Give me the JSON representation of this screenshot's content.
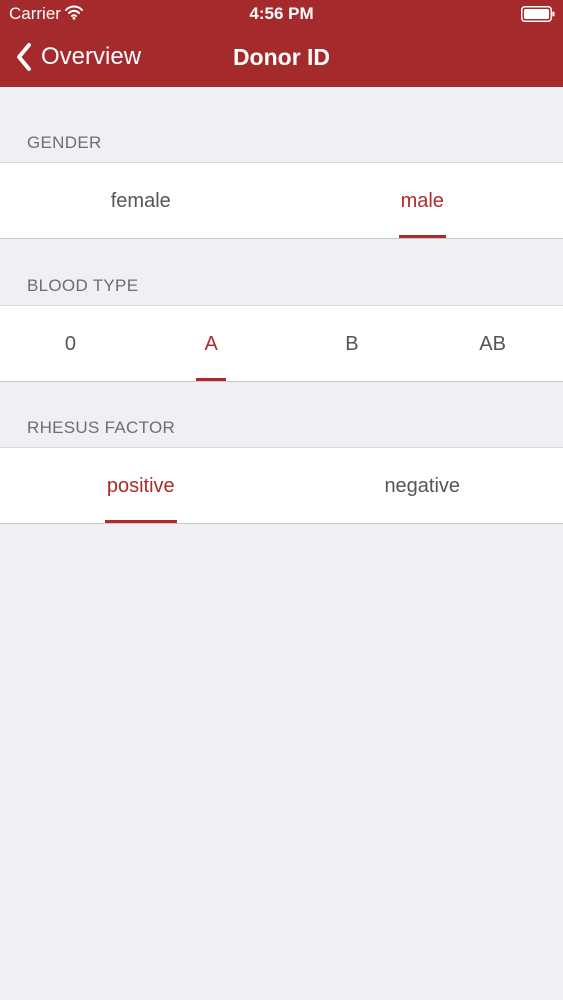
{
  "status_bar": {
    "carrier": "Carrier",
    "time": "4:56 PM",
    "wifi_icon": "wifi-icon",
    "battery_icon": "battery-icon"
  },
  "nav": {
    "back_label": "Overview",
    "back_icon": "chevron-left-icon",
    "title": "Donor ID"
  },
  "colors": {
    "accent": "#a52a2c",
    "selected_text": "#b0292d",
    "background": "#efeff4",
    "section_label": "#6d6d72",
    "option_text": "#555558"
  },
  "sections": [
    {
      "label": "GENDER",
      "options": [
        "female",
        "male"
      ],
      "selected": "male"
    },
    {
      "label": "BLOOD TYPE",
      "options": [
        "0",
        "A",
        "B",
        "AB"
      ],
      "selected": "A"
    },
    {
      "label": "RHESUS FACTOR",
      "options": [
        "positive",
        "negative"
      ],
      "selected": "positive"
    }
  ]
}
